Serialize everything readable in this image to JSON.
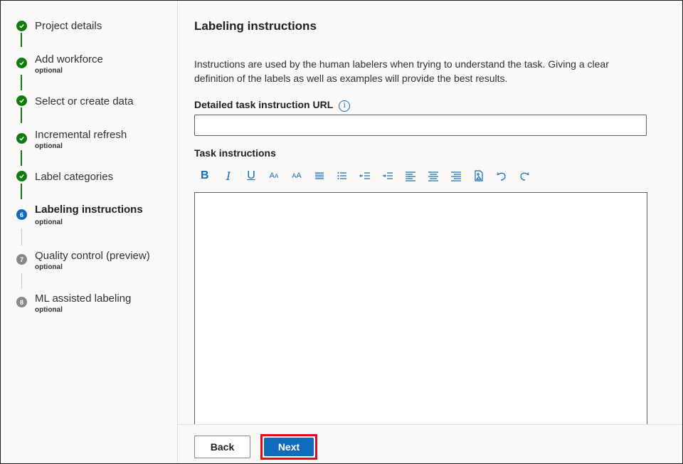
{
  "steps": [
    {
      "label": "Project details",
      "status": "done"
    },
    {
      "label": "Add workforce",
      "sub": "optional",
      "status": "done"
    },
    {
      "label": "Select or create data",
      "status": "done"
    },
    {
      "label": "Incremental refresh",
      "sub": "optional",
      "status": "done"
    },
    {
      "label": "Label categories",
      "status": "done"
    },
    {
      "label": "Labeling instructions",
      "sub": "optional",
      "status": "active",
      "number": "6"
    },
    {
      "label": "Quality control (preview)",
      "sub": "optional",
      "status": "pending",
      "number": "7"
    },
    {
      "label": "ML assisted labeling",
      "sub": "optional",
      "status": "pending",
      "number": "8"
    }
  ],
  "main": {
    "title": "Labeling instructions",
    "description": "Instructions are used by the human labelers when trying to understand the task. Giving a clear definition of the labels as well as examples will provide the best results.",
    "url_label": "Detailed task instruction URL",
    "url_value": "",
    "task_label": "Task instructions",
    "toolbar": [
      "bold-icon",
      "italic-icon",
      "underline-icon",
      "font-size-decrease-icon",
      "font-size-increase-icon",
      "bulleted-list-icon",
      "numbered-list-icon",
      "decrease-indent-icon",
      "increase-indent-icon",
      "align-left-icon",
      "align-center-icon",
      "align-right-icon",
      "insert-image-icon",
      "undo-icon",
      "redo-icon"
    ]
  },
  "footer": {
    "back_label": "Back",
    "next_label": "Next"
  },
  "colors": {
    "accent": "#0f6cbd",
    "done": "#107c10",
    "pending": "#8a8886",
    "highlight": "#e00b1c"
  }
}
